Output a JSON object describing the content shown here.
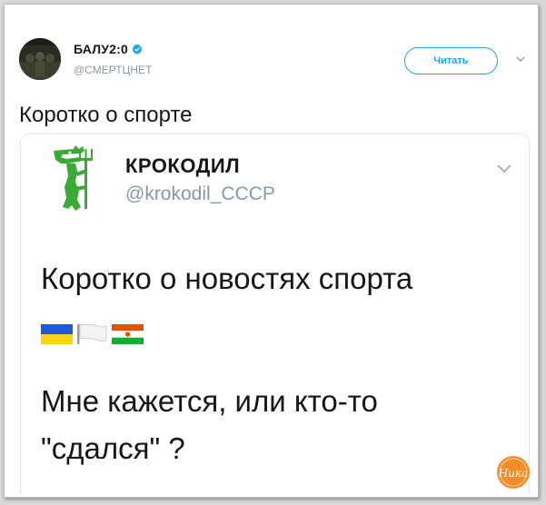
{
  "tweet": {
    "author_name": "БАЛУ2:0",
    "author_handle": "@СМЕРТЦНЕТ",
    "follow_label": "Читать",
    "text": "Коротко о спорте"
  },
  "quoted": {
    "name": "КРОКОДИЛ",
    "handle": "@krokodil_CCCP",
    "line1": "Коротко о новостях спорта",
    "line2": "Мне кажется, или кто-то",
    "line3": "\"сдался\" ?"
  },
  "flags": [
    "ukraine-flag",
    "white-flag",
    "niger-flag"
  ],
  "icons": {
    "avatar": "avatar",
    "verified": "verified-badge-icon",
    "caret": "chevron-down-icon",
    "logo": "krokodil-logo",
    "watermark": "watermark-logo"
  },
  "watermark_text": "Ника",
  "colors": {
    "accent": "#1da1f2",
    "logo_green": "#3aa935",
    "text": "#14171a",
    "muted": "#8899a6",
    "watermark": "#f28c28"
  }
}
